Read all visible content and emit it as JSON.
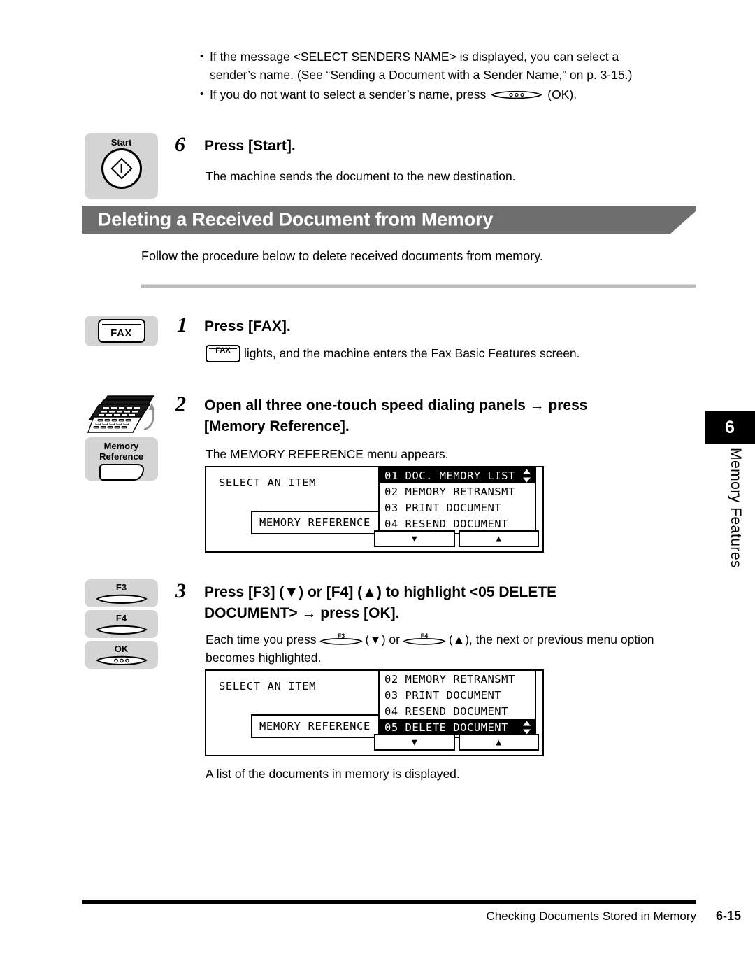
{
  "intro": {
    "bullets": [
      {
        "line1": "If the message <SELECT SENDERS NAME> is displayed, you can select a",
        "line2": "sender’s name. (See “Sending a Document with a Sender Name,” on p. 3-15.)"
      },
      {
        "pre": "If you do not want to select a sender’s name, press",
        "post": "(OK)."
      }
    ]
  },
  "step6": {
    "number": "6",
    "title": "Press [Start].",
    "body": "The machine sends the document to the new destination.",
    "key_label": "Start",
    "key_icon": "start-diamond-icon"
  },
  "section": {
    "title": "Deleting a Received Document from Memory",
    "intro": "Follow the procedure below to delete received documents from memory.",
    "banner_color": "#6e6e6e"
  },
  "step1": {
    "number": "1",
    "title": "Press [FAX].",
    "key_label": "FAX",
    "body_inline_key": "FAX",
    "body": "lights, and the machine enters the Fax Basic Features screen."
  },
  "step2": {
    "number": "2",
    "title_line1": "Open all three one-touch speed dialing panels → press",
    "title_line2": "[Memory Reference].",
    "body": "The MEMORY REFERENCE menu appears.",
    "key_label_line1": "Memory",
    "key_label_line2": "Reference",
    "panel_icon": "one-touch-panels-icon"
  },
  "lcd1": {
    "title": "SELECT AN ITEM",
    "field": "MEMORY REFERENCE",
    "menu": [
      {
        "text": "01 DOC. MEMORY LIST",
        "selected": true,
        "scroll": true
      },
      {
        "text": "02 MEMORY RETRANSMT",
        "selected": false,
        "scroll": false
      },
      {
        "text": "03 PRINT DOCUMENT",
        "selected": false,
        "scroll": false
      },
      {
        "text": "04 RESEND DOCUMENT",
        "selected": false,
        "scroll": false
      }
    ],
    "softkey_down": "▼",
    "softkey_up": "▲"
  },
  "step3": {
    "number": "3",
    "title_line1": "Press [F3] (▼) or [F4] (▲) to highlight <05 DELETE",
    "title_line2": "DOCUMENT> → press [OK].",
    "body_pre": "Each time you press",
    "body_mid1": "(▼) or",
    "body_mid2": "(▲), the next or previous menu option",
    "body_line2": "becomes highlighted.",
    "key_labels": [
      "F3",
      "F4",
      "OK"
    ],
    "inline_key_1": "F3",
    "inline_key_2": "F4"
  },
  "lcd2": {
    "title": "SELECT AN ITEM",
    "field": "MEMORY REFERENCE",
    "menu": [
      {
        "text": "02 MEMORY RETRANSMT",
        "selected": false,
        "scroll": false
      },
      {
        "text": "03 PRINT DOCUMENT",
        "selected": false,
        "scroll": false
      },
      {
        "text": "04 RESEND DOCUMENT",
        "selected": false,
        "scroll": false
      },
      {
        "text": "05 DELETE DOCUMENT",
        "selected": true,
        "scroll": true
      }
    ],
    "softkey_down": "▼",
    "softkey_up": "▲",
    "caption": "A list of the documents in memory is displayed."
  },
  "chapter_tab": {
    "number": "6",
    "label": "Memory Features"
  },
  "footer": {
    "text": "Checking Documents Stored in Memory",
    "page": "6-15"
  }
}
